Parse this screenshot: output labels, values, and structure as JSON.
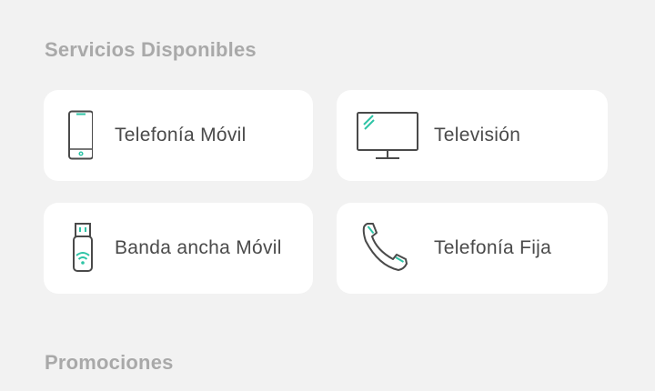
{
  "sections": {
    "services_title": "Servicios Disponibles",
    "promos_title": "Promociones"
  },
  "services": [
    {
      "label": "Telefonía Móvil",
      "icon": "mobile-phone-icon"
    },
    {
      "label": "Televisión",
      "icon": "television-icon"
    },
    {
      "label": "Banda ancha Móvil",
      "icon": "usb-modem-icon"
    },
    {
      "label": "Telefonía Fija",
      "icon": "landline-phone-icon"
    }
  ],
  "colors": {
    "background": "#f2f2f2",
    "card": "#ffffff",
    "heading": "#a9a9a9",
    "text": "#4a4a4a",
    "icon_stroke": "#4a4a4a",
    "accent": "#2ec4a6"
  }
}
